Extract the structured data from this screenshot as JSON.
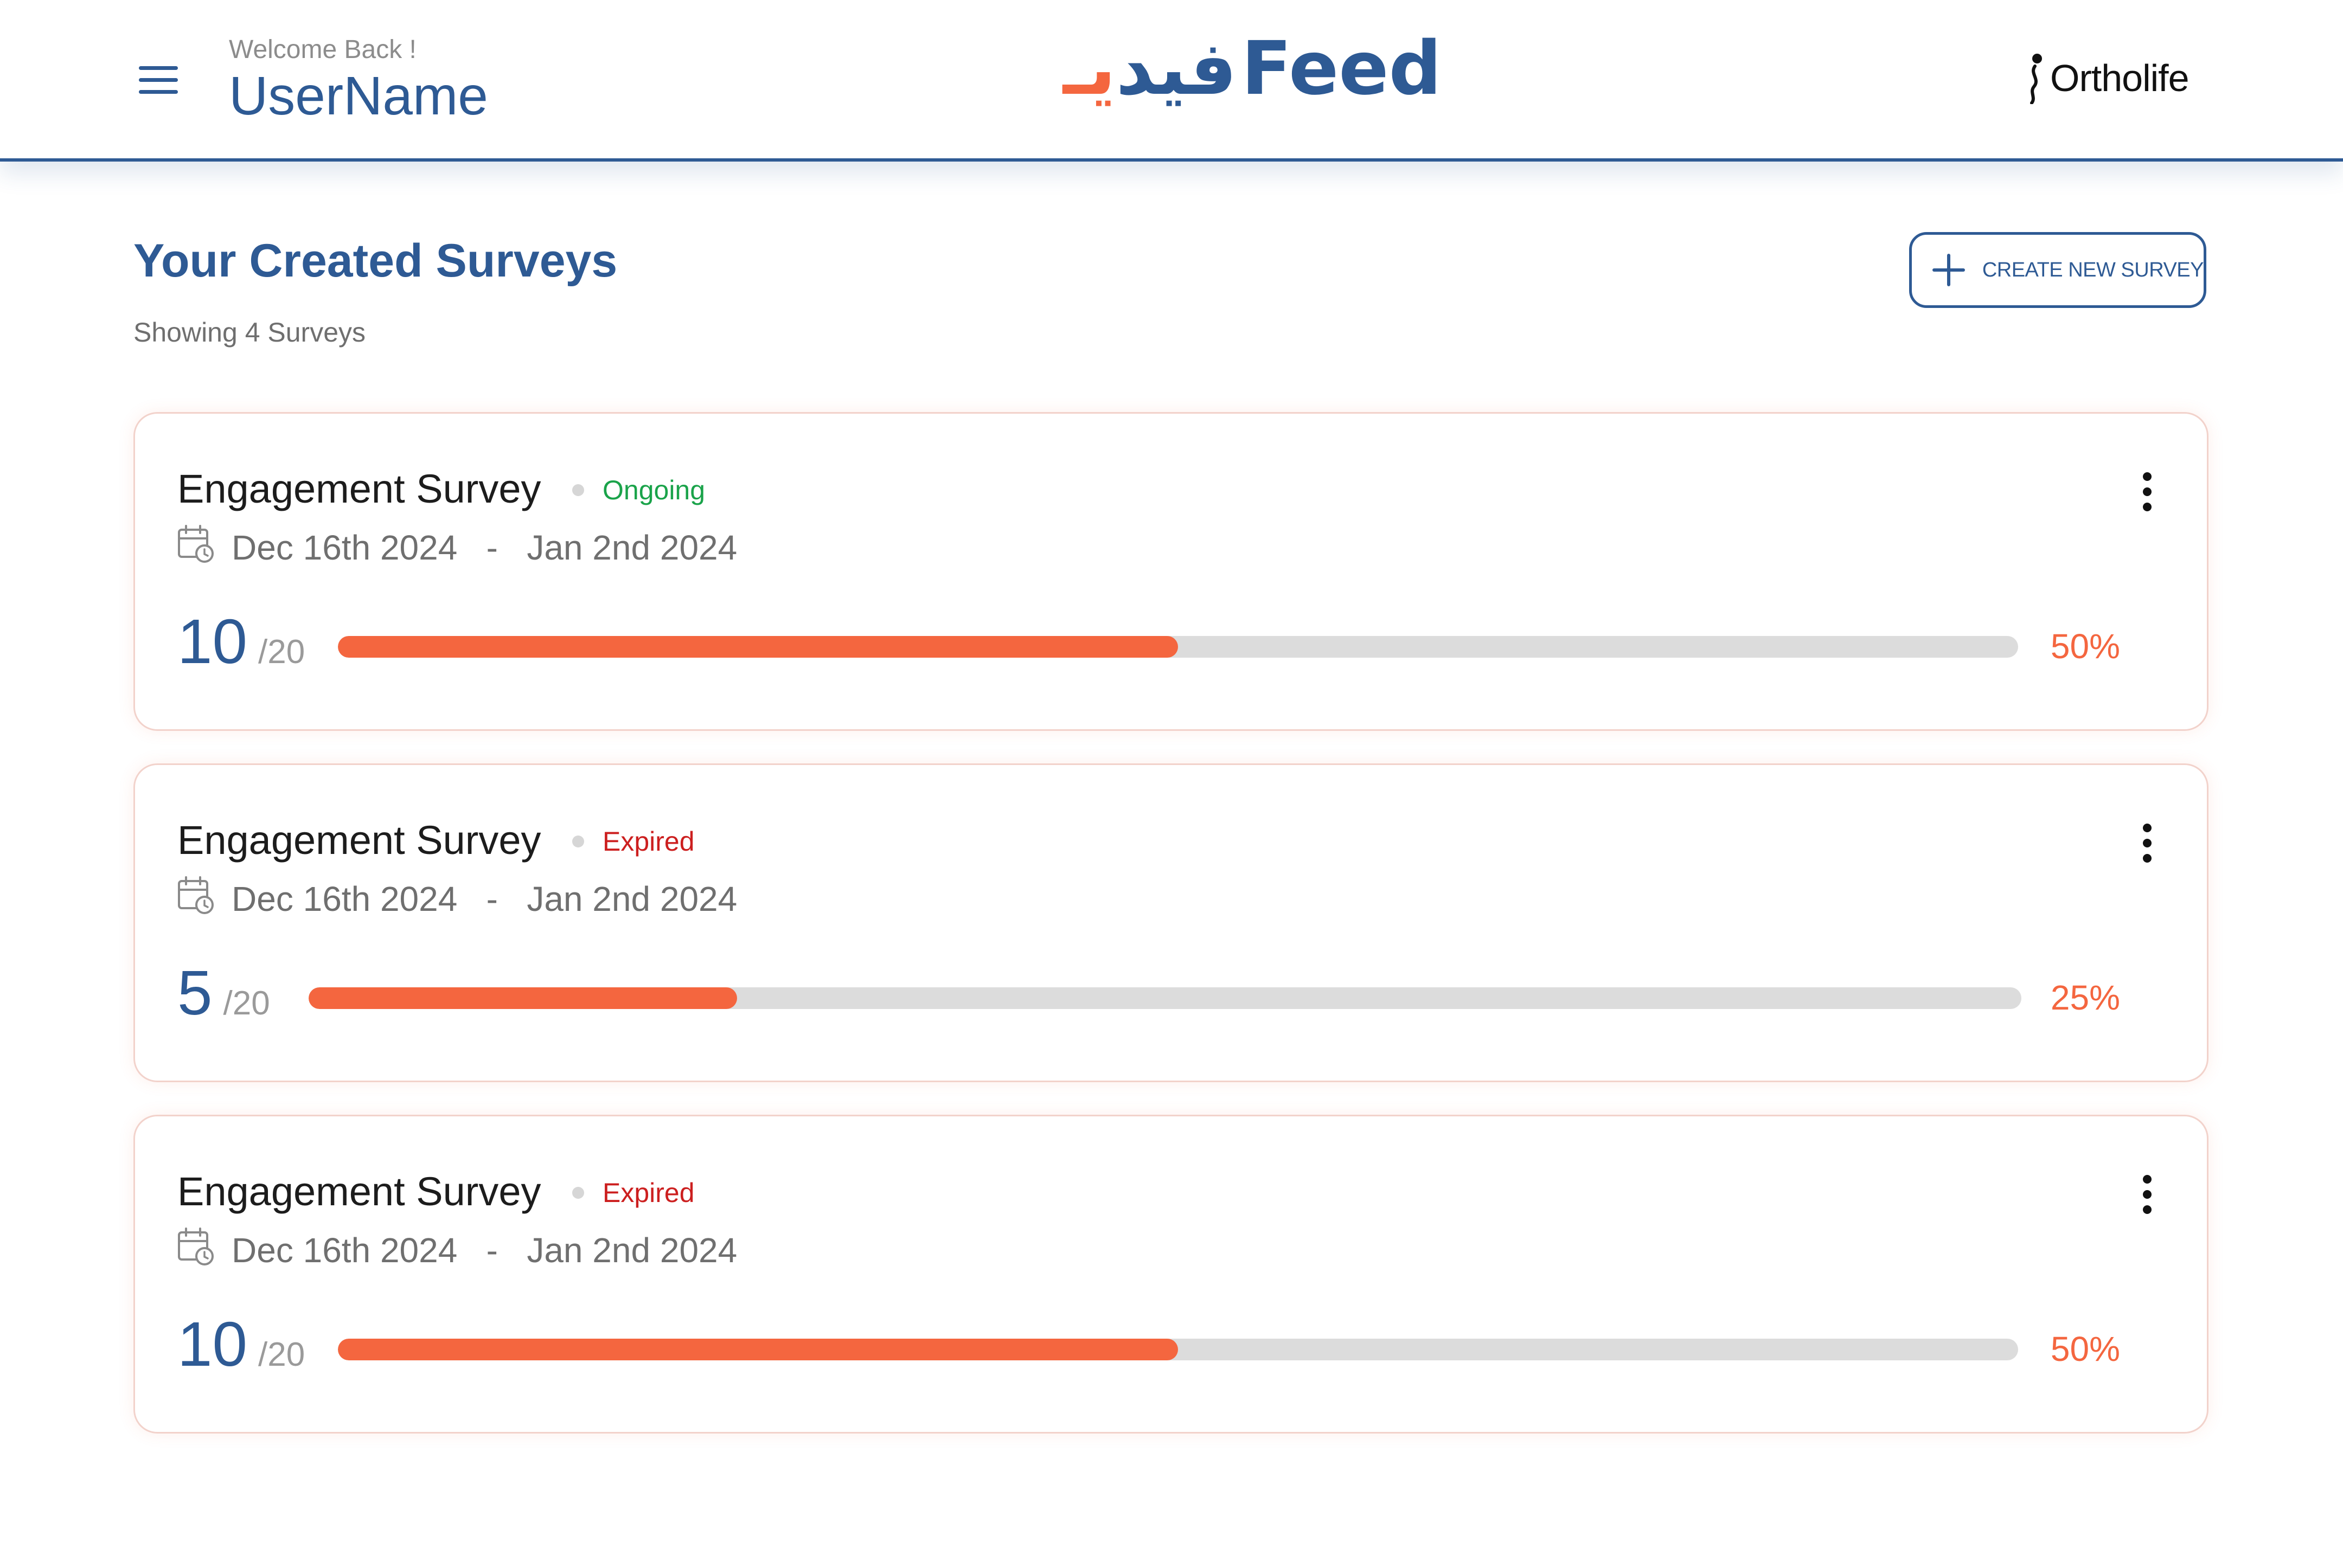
{
  "header": {
    "greeting": "Welcome Back !",
    "username": "UserName",
    "brand_arabic": "فيد",
    "brand_arabic_accent": "يـ",
    "brand_latin": "Feed",
    "client_name": "Ortholife"
  },
  "main": {
    "title": "Your Created Surveys",
    "count_text": "Showing 4 Surveys",
    "create_button_label": "CREATE NEW SURVEY"
  },
  "surveys": [
    {
      "title": "Engagement Survey",
      "status": "Ongoing",
      "status_color": "#1aa34a",
      "start_date": "Dec 16th 2024",
      "separator": "-",
      "end_date": "Jan 2nd 2024",
      "responses": "10",
      "total": "/20",
      "progress_percent": 50,
      "percent_text": "50%"
    },
    {
      "title": "Engagement Survey",
      "status": "Expired",
      "status_color": "#cc1f1f",
      "start_date": "Dec 16th 2024",
      "separator": "-",
      "end_date": "Jan 2nd 2024",
      "responses": "5",
      "total": "/20",
      "progress_percent": 25,
      "percent_text": "25%"
    },
    {
      "title": "Engagement Survey",
      "status": "Expired",
      "status_color": "#cc1f1f",
      "start_date": "Dec 16th 2024",
      "separator": "-",
      "end_date": "Jan 2nd 2024",
      "responses": "10",
      "total": "/20",
      "progress_percent": 50,
      "percent_text": "50%"
    }
  ],
  "icons": {
    "menu": "hamburger-menu-icon",
    "create": "plus-icon",
    "more": "more-vertical-icon",
    "dates": "calendar-clock-icon"
  },
  "colors": {
    "primary": "#2e5a94",
    "accent": "#f4663f",
    "track": "#dcdcdc"
  }
}
